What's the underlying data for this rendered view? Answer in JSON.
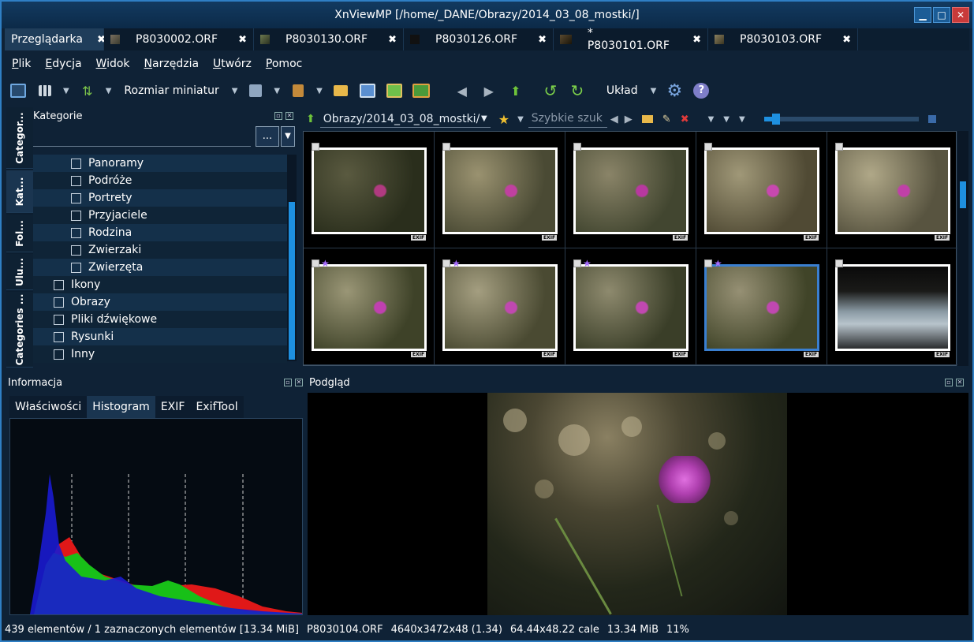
{
  "window": {
    "title": "XnViewMP [/home/_DANE/Obrazy/2014_03_08_mostki/]"
  },
  "tabs": [
    {
      "label": "Przeglądarka",
      "active": true
    },
    {
      "label": "P8030002.ORF"
    },
    {
      "label": "P8030130.ORF"
    },
    {
      "label": "P8030126.ORF"
    },
    {
      "label": "* P8030101.ORF"
    },
    {
      "label": "P8030103.ORF"
    }
  ],
  "menu": [
    "Plik",
    "Edycja",
    "Widok",
    "Narzędzia",
    "Utwórz",
    "Pomoc"
  ],
  "toolbar": {
    "thumb_size_label": "Rozmiar miniatur",
    "layout_label": "Układ"
  },
  "side_tabs": [
    "Categor...",
    "Kat...",
    "Fol...",
    "Ulu...",
    "Categories ..."
  ],
  "categories": {
    "title": "Kategorie",
    "filter_button": "...",
    "items": [
      {
        "label": "Panoramy",
        "level": 2
      },
      {
        "label": "Podróże",
        "level": 2
      },
      {
        "label": "Portrety",
        "level": 2
      },
      {
        "label": "Przyjaciele",
        "level": 2
      },
      {
        "label": "Rodzina",
        "level": 2
      },
      {
        "label": "Zwierzaki",
        "level": 2
      },
      {
        "label": "Zwierzęta",
        "level": 2
      },
      {
        "label": "Ikony",
        "level": 1
      },
      {
        "label": "Obrazy",
        "level": 1
      },
      {
        "label": "Pliki dźwiękowe",
        "level": 1
      },
      {
        "label": "Rysunki",
        "level": 1
      },
      {
        "label": "Inny",
        "level": 1
      }
    ]
  },
  "browser": {
    "path": "Obrazy/2014_03_08_mostki/",
    "search_placeholder": "Szybkie szuk",
    "thumb_badge": "EXIF",
    "starred": [
      false,
      false,
      false,
      false,
      false,
      true,
      true,
      true,
      true,
      false
    ]
  },
  "info": {
    "title": "Informacja",
    "tabs": [
      "Właściwości",
      "Histogram",
      "EXIF",
      "ExifTool"
    ],
    "active_tab": "Histogram"
  },
  "preview": {
    "title": "Podgląd"
  },
  "status": {
    "count": "439 elementów / 1 zaznaczonych elementów [13.34 MiB]",
    "filename": "P8030104.ORF",
    "dimensions": "4640x3472x48 (1.34)",
    "print_size": "64.44x48.22 cale",
    "size": "13.34 MiB",
    "zoom": "11%"
  },
  "colors": {
    "accent": "#2f7fc4",
    "selected_border": "#3a7fd0",
    "scroll_thumb": "#1e90e0"
  }
}
